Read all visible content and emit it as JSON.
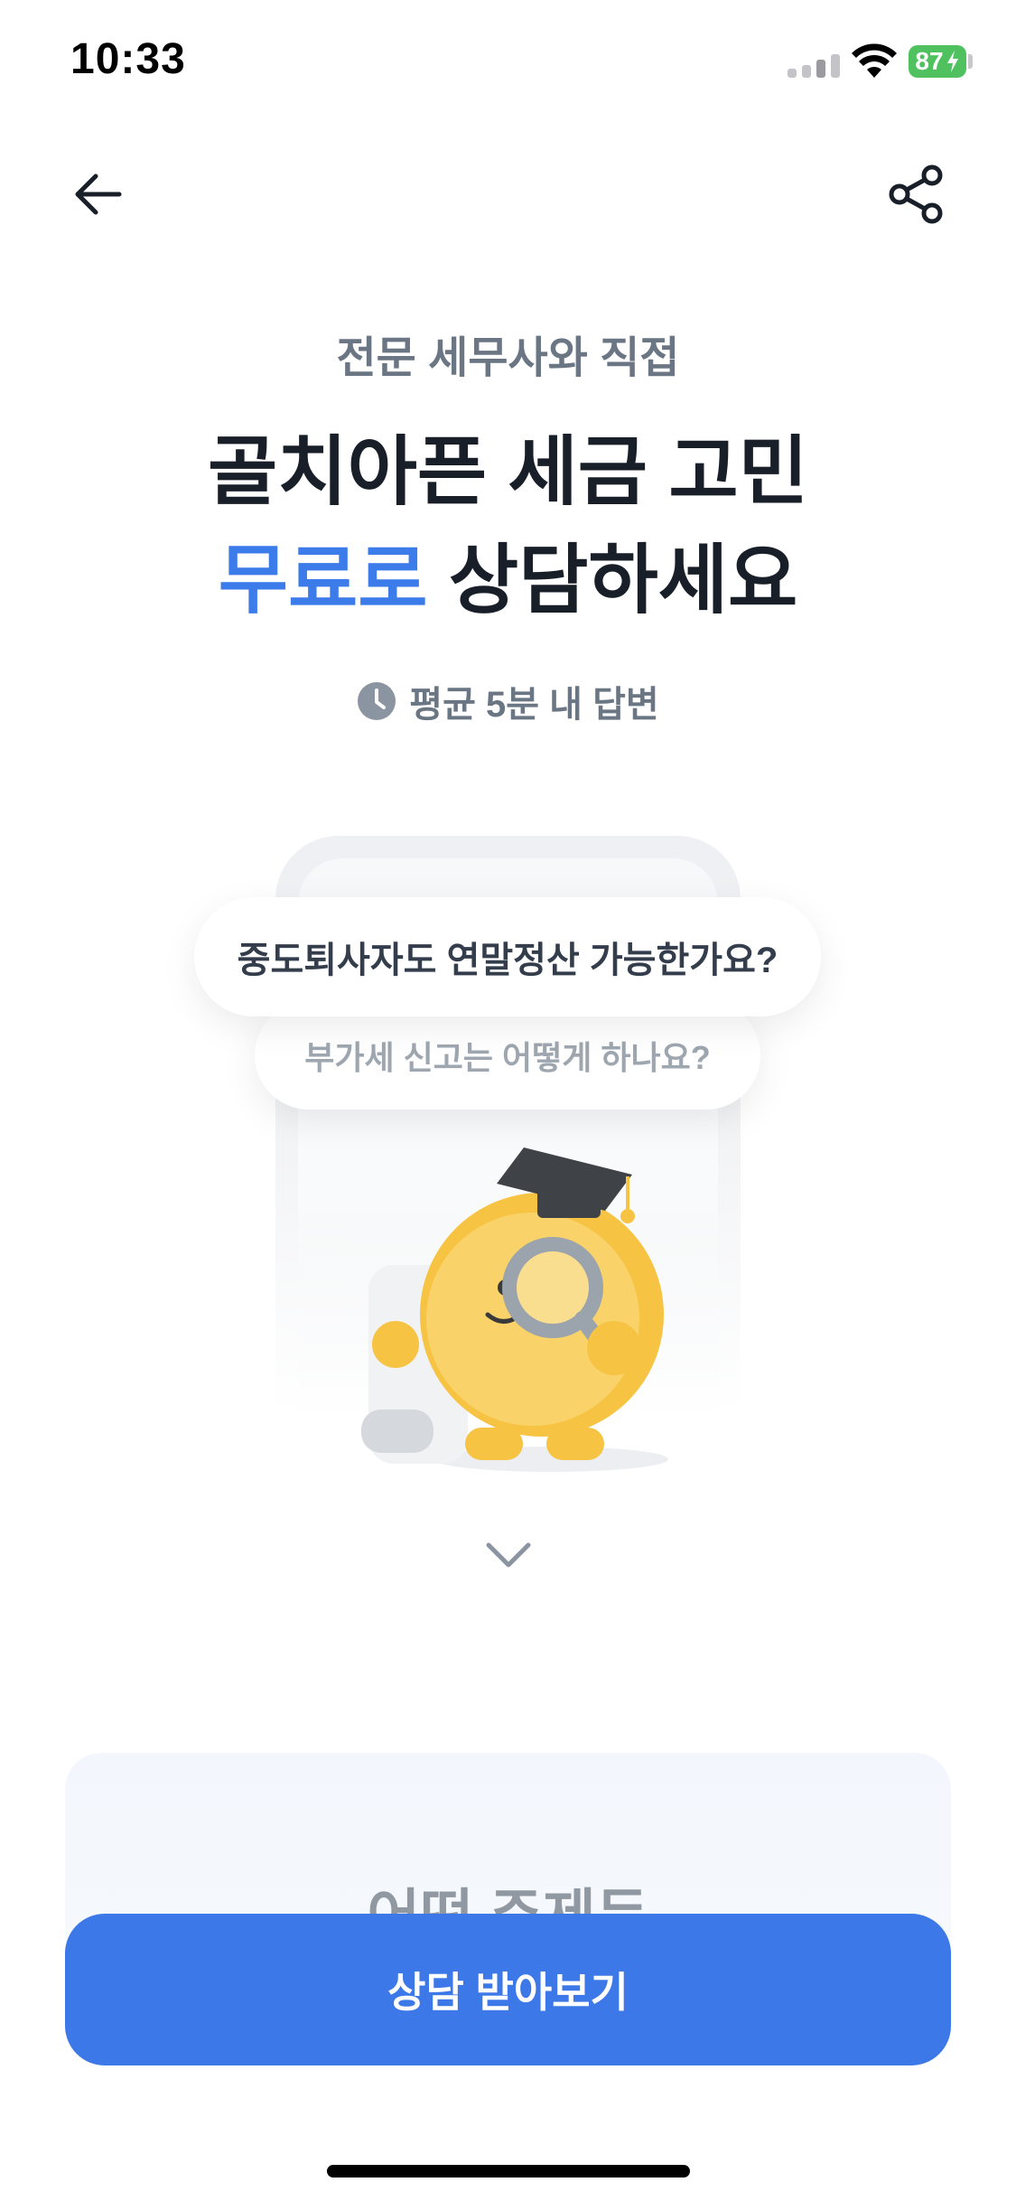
{
  "status_bar": {
    "time": "10:33",
    "battery": "87"
  },
  "nav": {
    "back_icon": "arrow-left-icon",
    "share_icon": "share-icon"
  },
  "hero": {
    "subtitle": "전문 세무사와 직접",
    "title_line1": "골치아픈 세금 고민",
    "title_line2_highlight": "무료로",
    "title_line2_rest": " 상담하세요",
    "answer_time": "평균 5분 내 답변",
    "highlight_color": "#3b7bea"
  },
  "illustration": {
    "question_1": "중도퇴사자도 연말정산 가능한가요?",
    "question_2": "부가세 신고는 어떻게 하나요?"
  },
  "card": {
    "title_partial": "어떤 주제든"
  },
  "cta": {
    "label": "상담 받아보기",
    "color": "#3c78e8"
  }
}
